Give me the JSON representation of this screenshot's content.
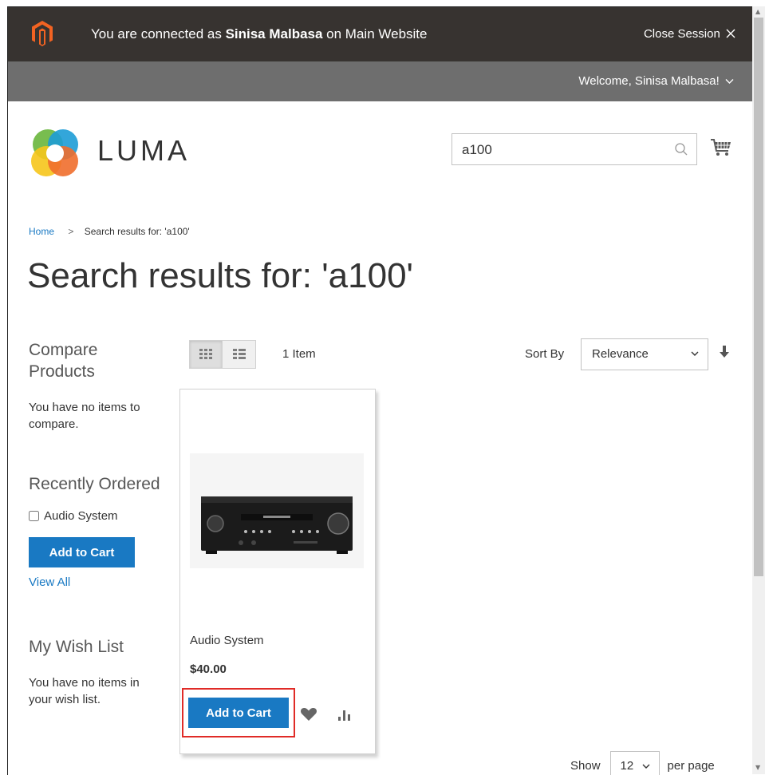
{
  "session_bar": {
    "prefix": "You are connected as ",
    "user": "Sinisa Malbasa",
    "suffix": " on Main Website",
    "close_label": "Close Session"
  },
  "header": {
    "welcome": "Welcome, Sinisa Malbasa!",
    "brand": "LUMA"
  },
  "search": {
    "value": "a100"
  },
  "breadcrumb": {
    "home": "Home",
    "separator": ">",
    "current": "Search results for: 'a100'"
  },
  "page": {
    "title": "Search results for: 'a100'"
  },
  "sidebar": {
    "compare_title": "Compare Products",
    "compare_empty": "You have no items to compare.",
    "recently_ordered_title": "Recently Ordered",
    "recent_item": "Audio System",
    "add_to_cart": "Add to Cart",
    "view_all": "View All",
    "wishlist_title": "My Wish List",
    "wishlist_empty": "You have no items in your wish list."
  },
  "toolbar": {
    "item_count": "1 Item",
    "sort_label": "Sort By",
    "sort_value": "Relevance",
    "show_label": "Show",
    "limit_value": "12",
    "per_page": "per page"
  },
  "product": {
    "name": "Audio System",
    "price": "$40.00",
    "add_to_cart": "Add to Cart"
  },
  "colors": {
    "primary": "#1979c3",
    "session_bar": "#373330",
    "welcome_bar": "#6e6e6e",
    "highlight": "#e02b27",
    "magento_orange": "#f26322"
  }
}
